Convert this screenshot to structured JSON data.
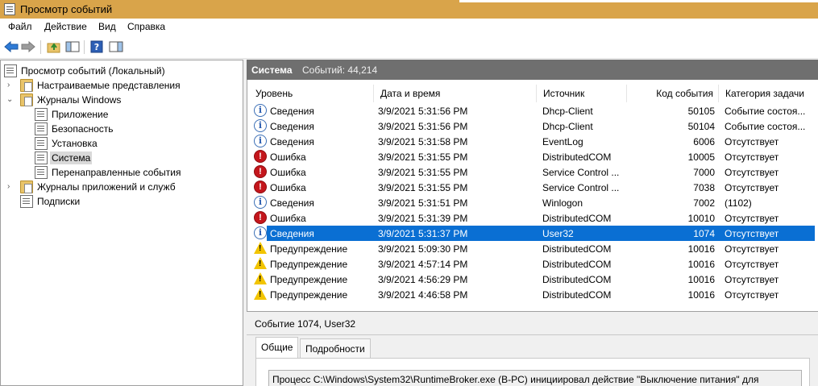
{
  "window": {
    "title": "Просмотр событий"
  },
  "menu": [
    "Файл",
    "Действие",
    "Вид",
    "Справка"
  ],
  "toolbar": {
    "buttons": [
      "back-icon",
      "forward-icon",
      "up-folder-icon",
      "show-hide-tree-icon",
      "help-icon",
      "show-hide-actions-icon"
    ]
  },
  "tree": {
    "root": "Просмотр событий (Локальный)",
    "custom_views": "Настраиваемые представления",
    "windows_logs": "Журналы Windows",
    "application": "Приложение",
    "security": "Безопасность",
    "setup": "Установка",
    "system": "Система",
    "forwarded": "Перенаправленные события",
    "apps_services": "Журналы приложений и служб",
    "subscriptions": "Подписки"
  },
  "panel": {
    "title": "Система",
    "count": "Событий: 44,214"
  },
  "columns": {
    "level": "Уровень",
    "datetime": "Дата и время",
    "source": "Источник",
    "event_id": "Код события",
    "category": "Категория задачи"
  },
  "events": [
    {
      "type": "info",
      "level": "Сведения",
      "datetime": "3/9/2021 5:31:56 PM",
      "source": "Dhcp-Client",
      "event_id": "50105",
      "category": "Событие состоя..."
    },
    {
      "type": "info",
      "level": "Сведения",
      "datetime": "3/9/2021 5:31:56 PM",
      "source": "Dhcp-Client",
      "event_id": "50104",
      "category": "Событие состоя..."
    },
    {
      "type": "info",
      "level": "Сведения",
      "datetime": "3/9/2021 5:31:58 PM",
      "source": "EventLog",
      "event_id": "6006",
      "category": "Отсутствует"
    },
    {
      "type": "error",
      "level": "Ошибка",
      "datetime": "3/9/2021 5:31:55 PM",
      "source": "DistributedCOM",
      "event_id": "10005",
      "category": "Отсутствует"
    },
    {
      "type": "error",
      "level": "Ошибка",
      "datetime": "3/9/2021 5:31:55 PM",
      "source": "Service Control ...",
      "event_id": "7000",
      "category": "Отсутствует"
    },
    {
      "type": "error",
      "level": "Ошибка",
      "datetime": "3/9/2021 5:31:55 PM",
      "source": "Service Control ...",
      "event_id": "7038",
      "category": "Отсутствует"
    },
    {
      "type": "info",
      "level": "Сведения",
      "datetime": "3/9/2021 5:31:51 PM",
      "source": "Winlogon",
      "event_id": "7002",
      "category": "(1102)"
    },
    {
      "type": "error",
      "level": "Ошибка",
      "datetime": "3/9/2021 5:31:39 PM",
      "source": "DistributedCOM",
      "event_id": "10010",
      "category": "Отсутствует"
    },
    {
      "type": "info",
      "level": "Сведения",
      "datetime": "3/9/2021 5:31:37 PM",
      "source": "User32",
      "event_id": "1074",
      "category": "Отсутствует",
      "selected": true
    },
    {
      "type": "warning",
      "level": "Предупреждение",
      "datetime": "3/9/2021 5:09:30 PM",
      "source": "DistributedCOM",
      "event_id": "10016",
      "category": "Отсутствует"
    },
    {
      "type": "warning",
      "level": "Предупреждение",
      "datetime": "3/9/2021 4:57:14 PM",
      "source": "DistributedCOM",
      "event_id": "10016",
      "category": "Отсутствует"
    },
    {
      "type": "warning",
      "level": "Предупреждение",
      "datetime": "3/9/2021 4:56:29 PM",
      "source": "DistributedCOM",
      "event_id": "10016",
      "category": "Отсутствует"
    },
    {
      "type": "warning",
      "level": "Предупреждение",
      "datetime": "3/9/2021 4:46:58 PM",
      "source": "DistributedCOM",
      "event_id": "10016",
      "category": "Отсутствует"
    }
  ],
  "detail": {
    "title": "Событие 1074, User32",
    "tab_general": "Общие",
    "tab_details": "Подробности",
    "message": "Процесс C:\\Windows\\System32\\RuntimeBroker.exe (B-PC) инициировал действие \"Выключение питания\" для"
  },
  "colors": {
    "titlebar": "#d9a44a",
    "header_band": "#6f6f6f",
    "selection": "#0a6fd3",
    "error": "#c4161c",
    "warning": "#f2c400",
    "info": "#2a5db0"
  }
}
